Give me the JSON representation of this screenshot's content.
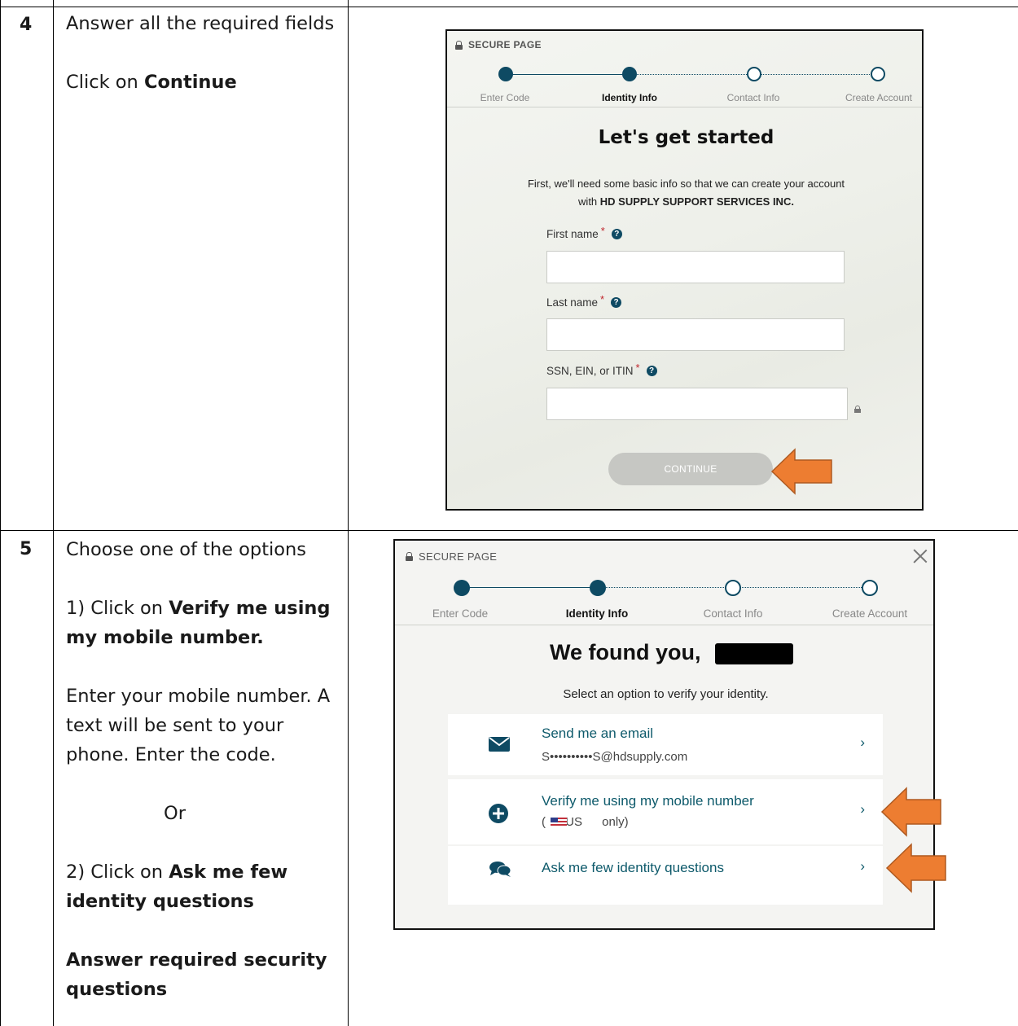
{
  "steps": [
    {
      "number": "4",
      "instructions": [
        "Answer all the required fields",
        "",
        "Click on ",
        "Continue"
      ]
    },
    {
      "number": "5",
      "lines": {
        "l1": "Choose one of the options",
        "l2_pre": "1) Click on ",
        "l2_bold": "Verify me using my mobile number.",
        "l3": "Enter your mobile number. A text will be sent to your phone. Enter the code.",
        "l4": "Or",
        "l5_pre": "2) Click on ",
        "l5_bold": "Ask me few identity questions",
        "l6_bold": "Answer required security questions"
      }
    }
  ],
  "step4_text": {
    "line1": "Answer all the required fields",
    "click_pre": "Click on ",
    "click_bold": "Continue"
  },
  "screen1": {
    "secure_label": "SECURE PAGE",
    "stepper": [
      "Enter Code",
      "Identity Info",
      "Contact Info",
      "Create Account"
    ],
    "heading": "Let's get started",
    "intro_line1": "First, we'll need some basic info so that we can create your account",
    "intro_with": "with ",
    "intro_company": "HD SUPPLY SUPPORT SERVICES INC.",
    "fields": {
      "first_name": "First name",
      "last_name": "Last name",
      "tax_id": "SSN, EIN, or ITIN"
    },
    "required_mark": "*",
    "help_glyph": "?",
    "continue_label": "CONTINUE"
  },
  "screen2": {
    "secure_label": "SECURE PAGE",
    "stepper": [
      "Enter Code",
      "Identity Info",
      "Contact Info",
      "Create Account"
    ],
    "heading": "We found you,",
    "subheading": "Select an option to verify your identity.",
    "options": [
      {
        "title": "Send me an email",
        "detail": "S••••••••••S@hdsupply.com",
        "icon": "envelope-icon"
      },
      {
        "title": "Verify me using my mobile number",
        "detail": "( US only)",
        "icon": "plus-circle-icon"
      },
      {
        "title": "Ask me few identity questions",
        "detail": "",
        "icon": "chat-bubbles-icon"
      }
    ],
    "chevron": "›"
  },
  "colors": {
    "accent": "#0e4a63",
    "link": "#0e5a6b",
    "arrow_fill": "#ed7d31",
    "arrow_stroke": "#ae5a21",
    "required": "#c0262d"
  }
}
